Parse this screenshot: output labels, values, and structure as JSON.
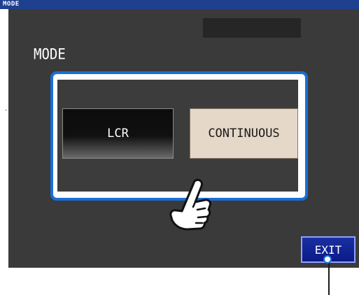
{
  "window": {
    "title": "MODE"
  },
  "screen": {
    "heading": "MODE",
    "buttons": {
      "lcr": "LCR",
      "continuous": "CONTINUOUS",
      "exit": "EXIT"
    },
    "selected_mode": "CONTINUOUS"
  },
  "colors": {
    "titlebar": "#1f3f8f",
    "screen_bg": "#3a3a3a",
    "highlight": "#1a6fd6",
    "selected_button": "#e6d8c8",
    "exit_button": "#0a1a88"
  },
  "icons": {
    "pointer": "pointing-hand-icon"
  }
}
